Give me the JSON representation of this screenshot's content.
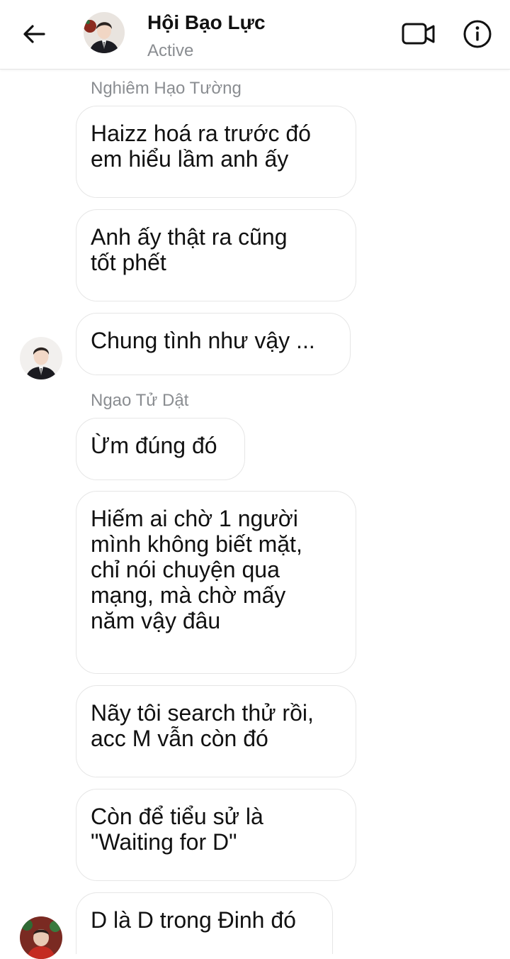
{
  "header": {
    "title": "Hội Bạo Lực",
    "status": "Active",
    "back_icon": "arrow-left-icon",
    "video_icon": "video-call-icon",
    "info_icon": "info-icon"
  },
  "messages": [
    {
      "sender": "Nghiêm Hạo Tường",
      "text": "Haizz hoá ra trước đó\nem hiểu lầm anh ấy"
    },
    {
      "text": "Anh ấy thật ra cũng\ntốt phết"
    },
    {
      "text": "Chung tình như vậy ..."
    },
    {
      "sender": "Ngao Tử Dật",
      "text": "Ừm đúng đó"
    },
    {
      "text": "Hiếm ai chờ 1 người\nmình không biết mặt,\nchỉ nói chuyện qua\nmạng, mà chờ mấy\nnăm vậy đâu"
    },
    {
      "text": "Nãy tôi search thử rồi,\nacc M vẫn còn đó"
    },
    {
      "text": "Còn để tiểu sử là\n\"Waiting for D\""
    },
    {
      "text": "D là D trong Đinh đó"
    }
  ],
  "colors": {
    "bubble_border": "#e6e6e6",
    "muted_text": "#8a8d91",
    "text": "#111111"
  }
}
